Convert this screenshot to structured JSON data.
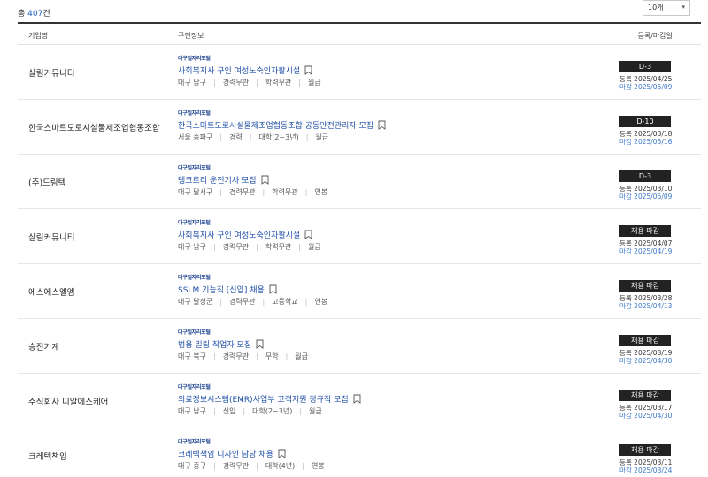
{
  "summary": {
    "prefix": "총 ",
    "count": "407",
    "suffix": "건"
  },
  "page_size": {
    "selected": "10개"
  },
  "columns": {
    "company": "기업명",
    "job": "구인정보",
    "dates": "등록/마감일"
  },
  "rows": [
    {
      "company": "살림커뮤니티",
      "portal": "대구일자리포털",
      "title": "사회복지사 구인 여성노숙인자활시설",
      "meta": [
        "대구 남구",
        "경력무관",
        "학력무관",
        "월급"
      ],
      "badge": "D-3",
      "registered": "등록 2025/04/25",
      "deadline": "마감 2025/05/09"
    },
    {
      "company": "한국스마트도로시설물제조업협동조합",
      "portal": "대구일자리포털",
      "title": "한국스마트도로시설물제조업협동조합 공동안전관리자 모집",
      "meta": [
        "서울 송파구",
        "경력",
        "대학(2~3년)",
        "월급"
      ],
      "badge": "D-10",
      "registered": "등록 2025/03/18",
      "deadline": "마감 2025/05/16"
    },
    {
      "company": "(주)드림텍",
      "portal": "대구일자리포털",
      "title": "탱크로리 운전기사 모집",
      "meta": [
        "대구 달서구",
        "경력무관",
        "학력무관",
        "연봉"
      ],
      "badge": "D-3",
      "registered": "등록 2025/03/10",
      "deadline": "마감 2025/05/09"
    },
    {
      "company": "살림커뮤니티",
      "portal": "대구일자리포털",
      "title": "사회복지사 구인 여성노숙인자활시설",
      "meta": [
        "대구 남구",
        "경력무관",
        "학력무관",
        "월급"
      ],
      "badge": "채용 마감",
      "registered": "등록 2025/04/07",
      "deadline": "마감 2025/04/19"
    },
    {
      "company": "에스에스엘엠",
      "portal": "대구일자리포털",
      "title": "SSLM 기능직 [신입] 채용",
      "meta": [
        "대구 달성군",
        "경력무관",
        "고등학교",
        "연봉"
      ],
      "badge": "채용 마감",
      "registered": "등록 2025/03/28",
      "deadline": "마감 2025/04/13"
    },
    {
      "company": "승진기계",
      "portal": "대구일자리포털",
      "title": "범용 밀링 작업자 모집",
      "meta": [
        "대구 북구",
        "경력무관",
        "무학",
        "월급"
      ],
      "badge": "채용 마감",
      "registered": "등록 2025/03/19",
      "deadline": "마감 2025/04/30"
    },
    {
      "company": "주식회사 디알에스케어",
      "portal": "대구일자리포털",
      "title": "의료정보시스템(EMR)사업부 고객지원 정규직 모집",
      "meta": [
        "대구 남구",
        "신입",
        "대학(2~3년)",
        "월급"
      ],
      "badge": "채용 마감",
      "registered": "등록 2025/03/17",
      "deadline": "마감 2025/04/30"
    },
    {
      "company": "크레텍책임",
      "portal": "대구일자리포털",
      "title": "크레텍책임 디자인 담당 채용",
      "meta": [
        "대구 중구",
        "경력무관",
        "대학(4년)",
        "연봉"
      ],
      "badge": "채용 마감",
      "registered": "등록 2025/03/11",
      "deadline": "마감 2025/03/24"
    }
  ],
  "colors": {
    "accent_blue": "#1f4fa8",
    "deadline_blue": "#3b78c9",
    "badge_bg": "#222222"
  },
  "icons": {
    "bookmark": "bookmark-icon",
    "dropdown": "chevron-down-icon"
  }
}
